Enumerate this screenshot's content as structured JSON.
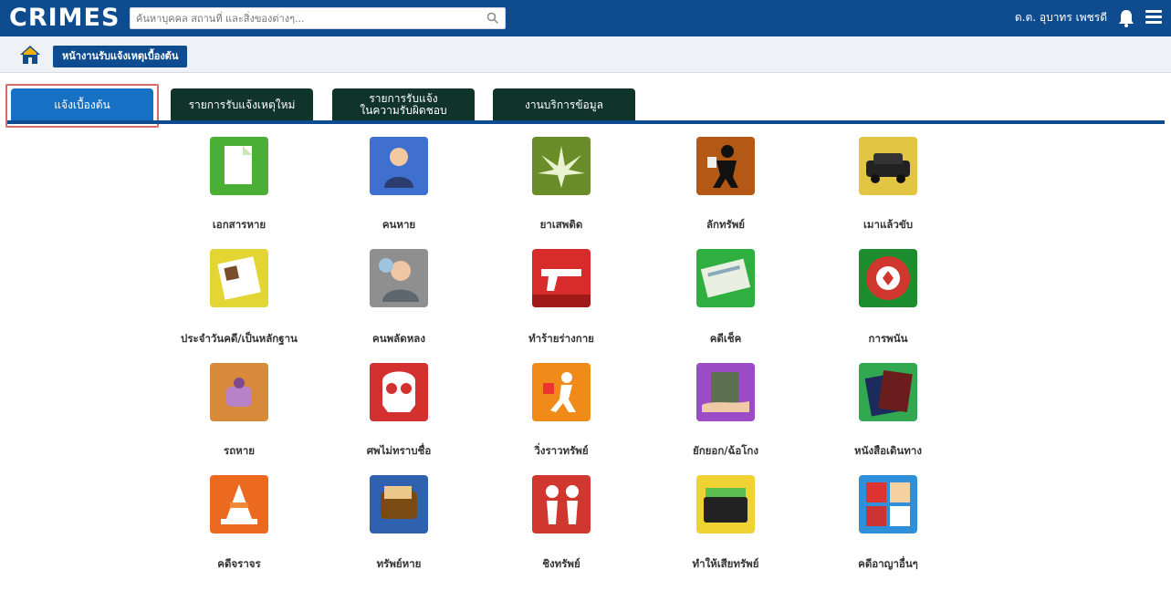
{
  "app": {
    "logo": "CRIMES",
    "search_placeholder": "ค้นหาบุคคล สถานที่ และสิ่งของต่างๆ...",
    "user_name": "ด.ต. อุบาทร เพชรดี"
  },
  "breadcrumb": {
    "current": "หน้างานรับแจ้งเหตุเบื้องต้น"
  },
  "tabs": [
    {
      "label": "แจ้งเบื้องต้น"
    },
    {
      "label": "รายการรับแจ้งเหตุใหม่"
    },
    {
      "label": "รายการรับแจ้ง\nในความรับผิดชอบ"
    },
    {
      "label": "งานบริการข้อมูล"
    }
  ],
  "categories": [
    {
      "label": "เอกสารหาย",
      "icon": "document-icon",
      "color": "#4caf35"
    },
    {
      "label": "คนหาย",
      "icon": "person-icon",
      "color": "#3f6fcf"
    },
    {
      "label": "ยาเสพติด",
      "icon": "cannabis-leaf-icon",
      "color": "#6a8d2a"
    },
    {
      "label": "ลักทรัพย์",
      "icon": "thief-icon",
      "color": "#b45816"
    },
    {
      "label": "เมาแล้วขับ",
      "icon": "car-icon",
      "color": "#e3c544"
    },
    {
      "label": "ประจำวันคดี/เป็นหลักฐาน",
      "icon": "notebook-icon",
      "color": "#e2d534"
    },
    {
      "label": "คนพลัดหลง",
      "icon": "lost-person-icon",
      "color": "#8f8f8f"
    },
    {
      "label": "ทำร้ายร่างกาย",
      "icon": "gun-icon",
      "color": "#d82b2b"
    },
    {
      "label": "คดีเช็ค",
      "icon": "cheque-icon",
      "color": "#2faf3f"
    },
    {
      "label": "การพนัน",
      "icon": "casino-chip-icon",
      "color": "#1c8d2f"
    },
    {
      "label": "รถหาย",
      "icon": "lost-car-icon",
      "color": "#d88a3b"
    },
    {
      "label": "ศพไม่ทราบชื่อ",
      "icon": "skull-icon",
      "color": "#d3312f"
    },
    {
      "label": "วิ่งราวทรัพย์",
      "icon": "snatch-thief-icon",
      "color": "#f08a18"
    },
    {
      "label": "ยักยอก/ฉ้อโกง",
      "icon": "money-hand-icon",
      "color": "#9b4bc6"
    },
    {
      "label": "หนังสือเดินทาง",
      "icon": "passport-icon",
      "color": "#32a851"
    },
    {
      "label": "คดีจราจร",
      "icon": "traffic-cone-icon",
      "color": "#ec6a1f"
    },
    {
      "label": "ทรัพย์หาย",
      "icon": "wallet-icon",
      "color": "#3060b0"
    },
    {
      "label": "ชิงทรัพย์",
      "icon": "robbery-icon",
      "color": "#d0382f"
    },
    {
      "label": "ทำให้เสียทรัพย์",
      "icon": "damaged-wallet-icon",
      "color": "#f0d332"
    },
    {
      "label": "คดีอาญาอื่นๆ",
      "icon": "other-cases-icon",
      "color": "#2f8fd8"
    }
  ]
}
